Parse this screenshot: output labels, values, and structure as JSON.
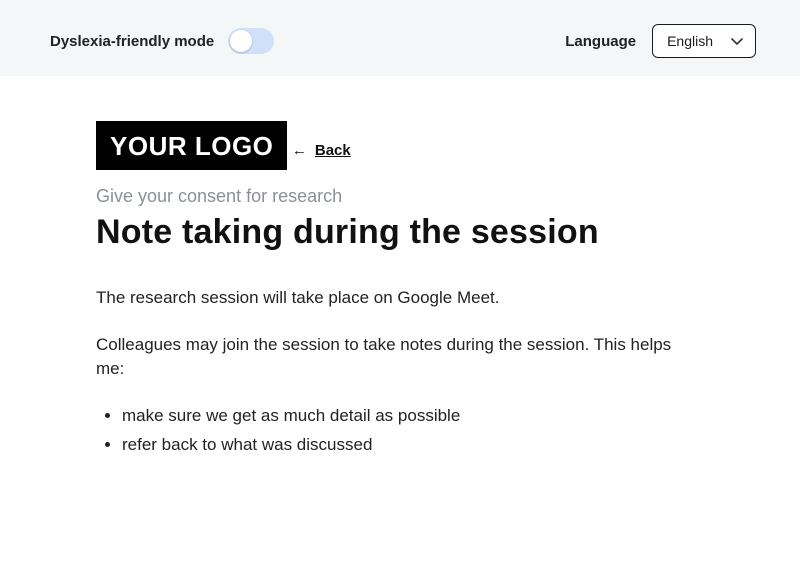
{
  "topbar": {
    "dyslexia_label": "Dyslexia-friendly mode",
    "language_label": "Language",
    "language_selected": "English"
  },
  "logo_text": "YOUR LOGO",
  "back": {
    "label": "Back"
  },
  "eyebrow": "Give your consent for research",
  "title": "Note taking during the session",
  "body": {
    "p1": "The research session will take place on Google Meet.",
    "p2": "Colleagues may join the session to take notes during the session. This helps me:",
    "bullets": [
      "make sure we get as much detail as possible",
      "refer back to what was discussed"
    ]
  }
}
